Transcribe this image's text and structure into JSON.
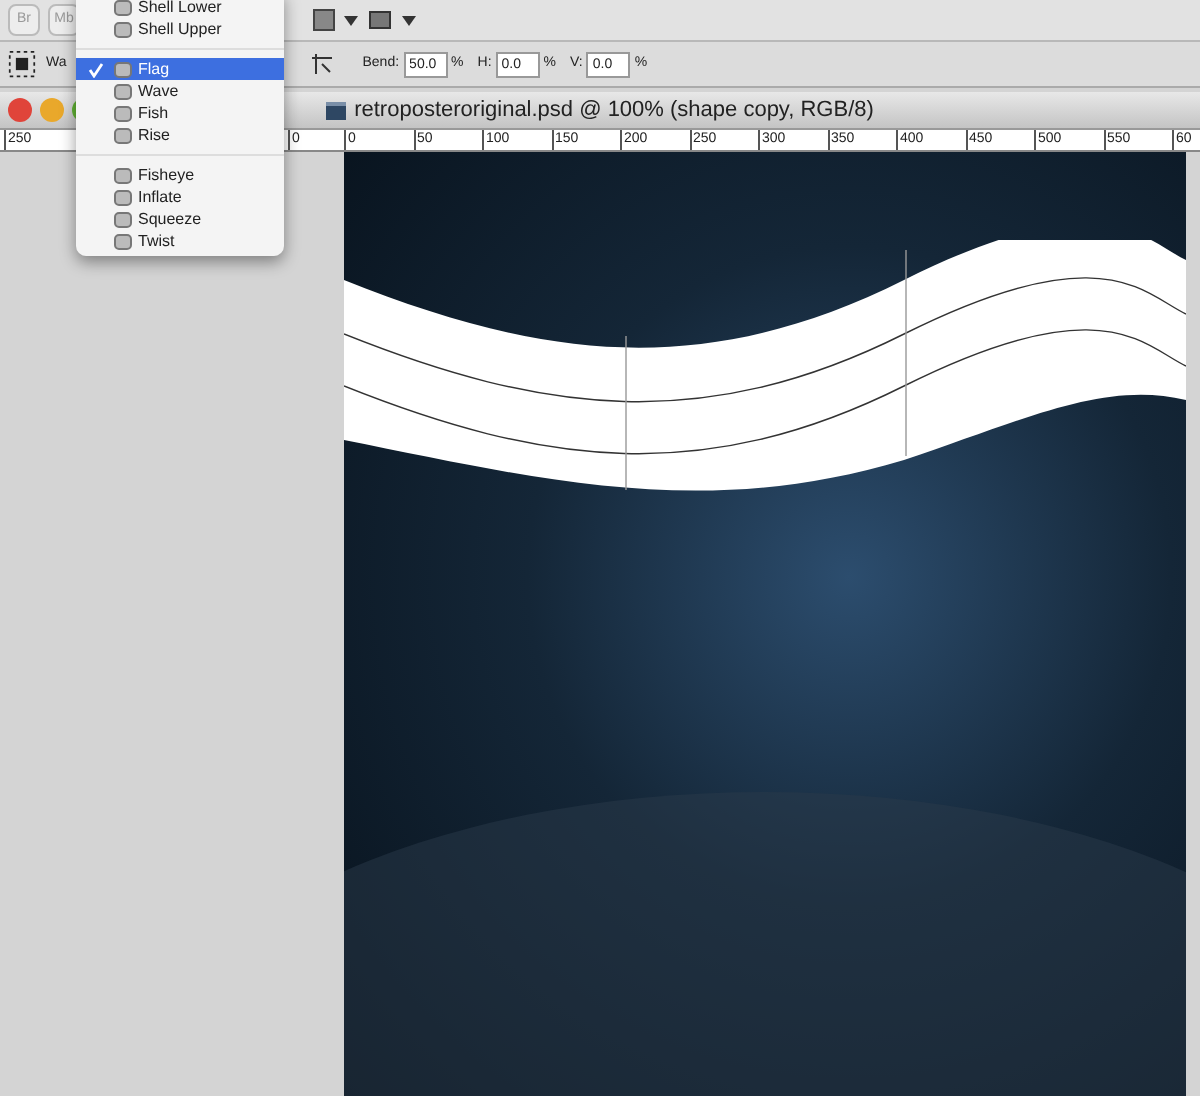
{
  "toolbar": {
    "buttons": [
      "Br",
      "Mb"
    ]
  },
  "options_bar": {
    "label": "Wa",
    "fields": [
      {
        "label": "Bend:",
        "value": "50.0",
        "unit": "%"
      },
      {
        "label": "H:",
        "value": "0.0",
        "unit": "%"
      },
      {
        "label": "V:",
        "value": "0.0",
        "unit": "%"
      }
    ]
  },
  "document": {
    "title": "retroposteroriginal.psd @ 100% (shape copy, RGB/8)"
  },
  "ruler": {
    "left_labels": [
      "250",
      "0"
    ],
    "labels": [
      "0",
      "50",
      "100",
      "150",
      "200",
      "250",
      "300",
      "350",
      "400",
      "450",
      "500",
      "550",
      "60"
    ]
  },
  "warp_menu": {
    "sections": [
      {
        "items": [
          {
            "label": "Shell Lower",
            "selected": false
          },
          {
            "label": "Shell Upper",
            "selected": false
          }
        ]
      },
      {
        "items": [
          {
            "label": "Flag",
            "selected": true
          },
          {
            "label": "Wave",
            "selected": false
          },
          {
            "label": "Fish",
            "selected": false
          },
          {
            "label": "Rise",
            "selected": false
          }
        ]
      },
      {
        "items": [
          {
            "label": "Fisheye",
            "selected": false
          },
          {
            "label": "Inflate",
            "selected": false
          },
          {
            "label": "Squeeze",
            "selected": false
          },
          {
            "label": "Twist",
            "selected": false
          }
        ]
      }
    ]
  }
}
